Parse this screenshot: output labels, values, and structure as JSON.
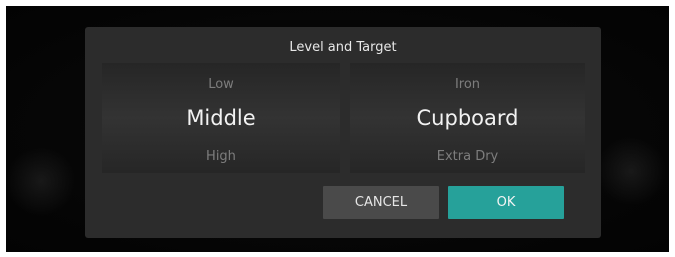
{
  "dialog": {
    "title": "Level and Target",
    "level_picker": {
      "previous": "Low",
      "selected": "Middle",
      "next": "High"
    },
    "target_picker": {
      "previous": "Iron",
      "selected": "Cupboard",
      "next": "Extra Dry"
    },
    "buttons": {
      "cancel_label": "CANCEL",
      "ok_label": "OK"
    }
  },
  "colors": {
    "accent": "#26a19a",
    "dialog_bg": "#2c2c2c",
    "cancel_bg": "#4a4a4a"
  }
}
